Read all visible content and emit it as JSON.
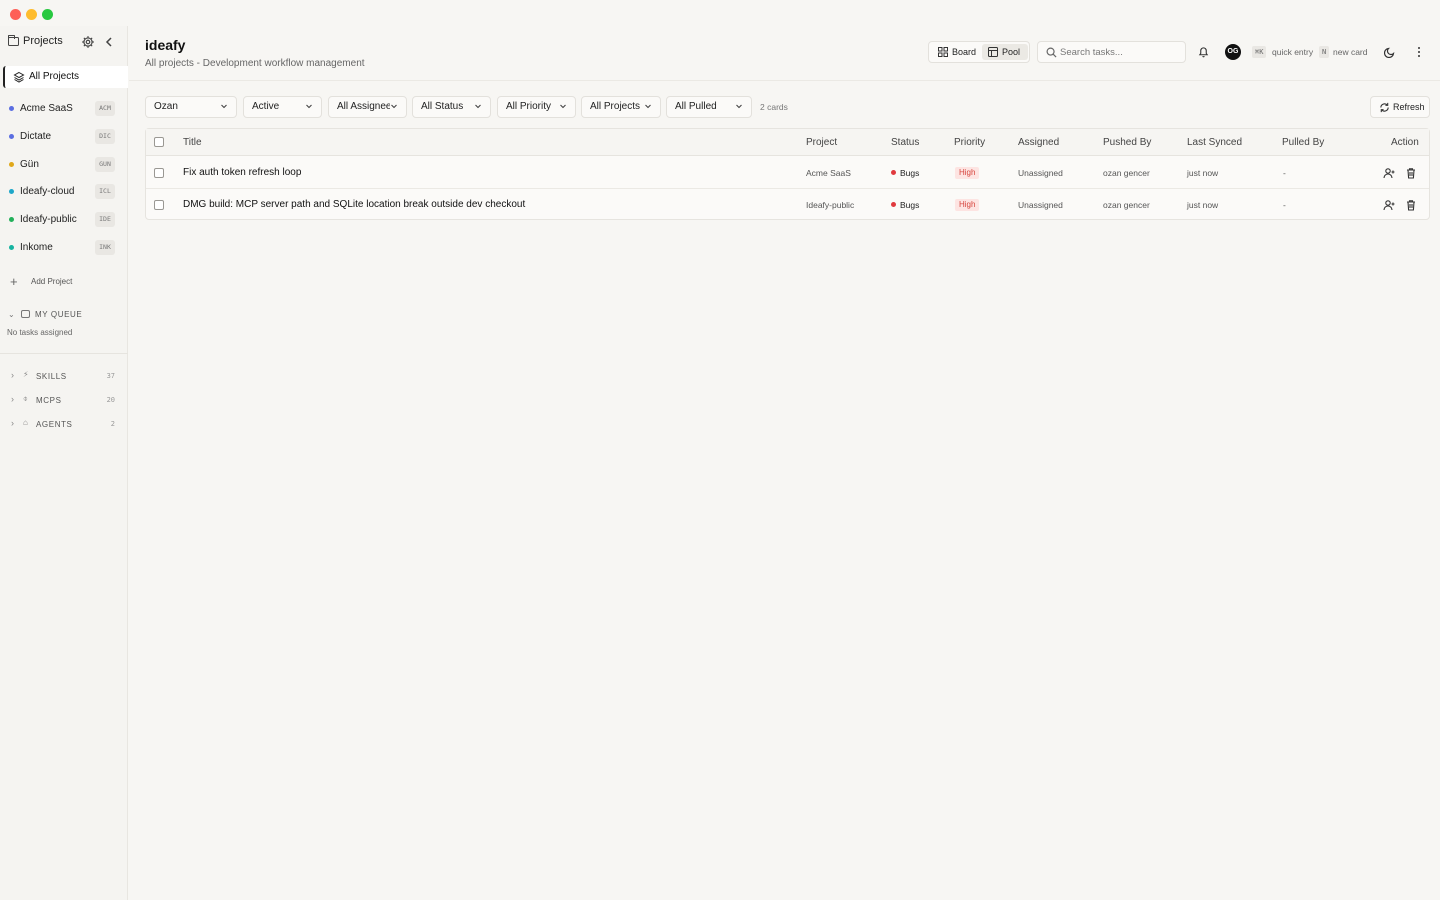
{
  "window": {
    "controls": [
      "close",
      "minimize",
      "maximize"
    ]
  },
  "sidebar": {
    "title": "Projects",
    "all_projects_label": "All Projects",
    "projects": [
      {
        "name": "Acme SaaS",
        "code": "ACM",
        "color": "#5b6ee1"
      },
      {
        "name": "Dictate",
        "code": "DIC",
        "color": "#5b6ee1"
      },
      {
        "name": "Gün",
        "code": "GUN",
        "color": "#e0a81a"
      },
      {
        "name": "Ideafy-cloud",
        "code": "ICL",
        "color": "#1ea7c9"
      },
      {
        "name": "Ideafy-public",
        "code": "IDE",
        "color": "#22b05a"
      },
      {
        "name": "Inkome",
        "code": "INK",
        "color": "#16b3a0"
      }
    ],
    "add_project_label": "Add Project",
    "my_queue": {
      "label": "MY QUEUE",
      "empty_text": "No tasks assigned"
    },
    "sections": [
      {
        "label": "SKILLS",
        "count": "37",
        "icon": "bolt-icon"
      },
      {
        "label": "MCPS",
        "count": "20",
        "icon": "plug-icon"
      },
      {
        "label": "AGENTS",
        "count": "2",
        "icon": "bot-icon"
      }
    ]
  },
  "header": {
    "title": "ideafy",
    "subtitle": "All projects - Development workflow management",
    "views": [
      {
        "label": "Board",
        "active": false
      },
      {
        "label": "Pool",
        "active": true
      }
    ],
    "search_placeholder": "Search tasks...",
    "avatar_initials": "OG",
    "shortcuts": [
      {
        "key": "⌘K",
        "label": "quick entry"
      },
      {
        "key": "N",
        "label": "new card"
      }
    ]
  },
  "filters": {
    "items": [
      "Ozan",
      "Active",
      "All Assignees",
      "All Status",
      "All Priority",
      "All Projects",
      "All Pulled"
    ],
    "card_count": "2 cards",
    "refresh_label": "Refresh"
  },
  "table": {
    "columns": [
      "Title",
      "Project",
      "Status",
      "Priority",
      "Assigned",
      "Pushed By",
      "Last Synced",
      "Pulled By",
      "Action"
    ],
    "rows": [
      {
        "title": "Fix auth token refresh loop",
        "project": "Acme SaaS",
        "status": "Bugs",
        "priority": "High",
        "assigned": "Unassigned",
        "pushed_by": "ozan gencer",
        "last_synced": "just now",
        "pulled_by": "-"
      },
      {
        "title": "DMG build: MCP server path and SQLite location break outside dev checkout",
        "project": "Ideafy-public",
        "status": "Bugs",
        "priority": "High",
        "assigned": "Unassigned",
        "pushed_by": "ozan gencer",
        "last_synced": "just now",
        "pulled_by": "-"
      }
    ]
  },
  "colors": {
    "status_bugs": "#e0393e",
    "priority_high_bg": "#fde4e2",
    "priority_high_fg": "#d6453d"
  }
}
